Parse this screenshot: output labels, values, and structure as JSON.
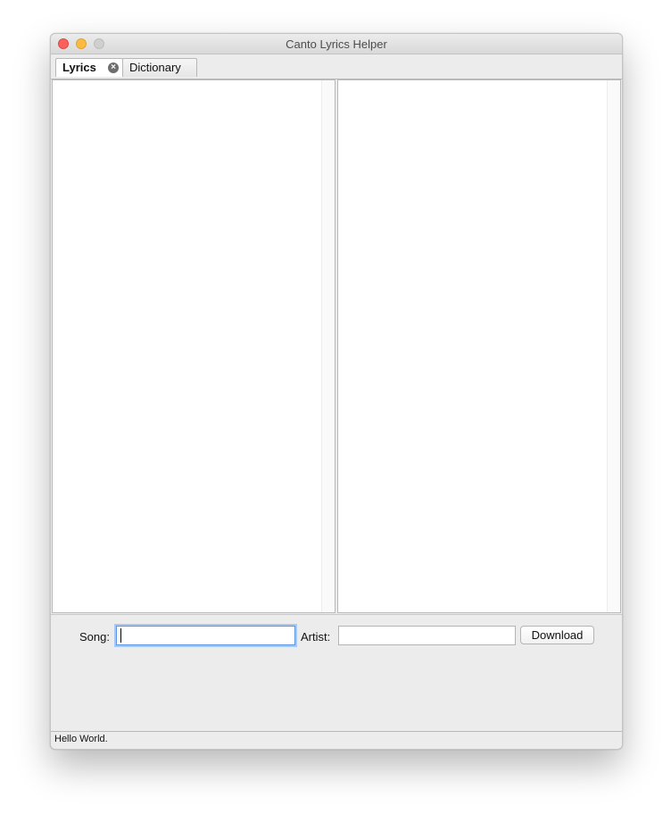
{
  "window": {
    "title": "Canto Lyrics Helper"
  },
  "tabs": [
    {
      "label": "Lyrics",
      "active": true,
      "closable": true
    },
    {
      "label": "Dictionary",
      "active": false
    }
  ],
  "form": {
    "song_label": "Song:",
    "song_value": "",
    "artist_label": "Artist:",
    "artist_value": "",
    "download_label": "Download"
  },
  "status": {
    "text": "Hello World."
  },
  "icons": {
    "tab_close": "close-circle-icon"
  },
  "colors": {
    "close_light": "#fc605c",
    "minimize_light": "#fdbc40",
    "zoom_light": "#cfcfcf",
    "focus_ring": "#5b96e6"
  }
}
